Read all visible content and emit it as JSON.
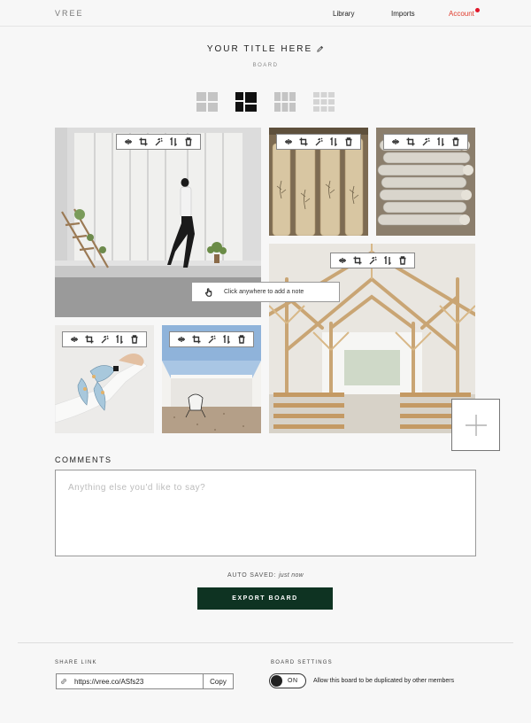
{
  "brand": "VREE",
  "nav": {
    "library": "Library",
    "imports": "Imports",
    "account": "Account",
    "account_notification": true
  },
  "board": {
    "title": "YOUR TITLE HERE",
    "subtitle": "BOARD"
  },
  "layouts": {
    "selected": 1,
    "options": [
      "2x2 grid",
      "mosaic",
      "3x2 grid",
      "3x3 grid"
    ]
  },
  "toolbar_icons": [
    "adjust-icon",
    "crop-icon",
    "magic-wand-icon",
    "flip-icon",
    "trash-icon"
  ],
  "photos": [
    "Person walking in a white gallery with ladder and plants",
    "Rolled paper scrolls with botanical drawings",
    "Stacked rolled fabric swatches",
    "Timber-framed chapel interior with pews",
    "Wrist with patterned silk scarf",
    "Butterfly chair in an open courtyard"
  ],
  "note_prompt": "Click anywhere to add a note",
  "comments": {
    "label": "COMMENTS",
    "placeholder": "Anything else you'd like to say?",
    "value": ""
  },
  "autosave": {
    "label": "AUTO SAVED:",
    "time": "just now"
  },
  "export_label": "EXPORT BOARD",
  "share": {
    "label": "SHARE LINK",
    "url": "https://vree.co/ASfs23",
    "copy_label": "Copy"
  },
  "settings": {
    "label": "BOARD SETTINGS",
    "toggle_state": "ON",
    "toggle_desc": "Allow this board to be duplicated by other members"
  },
  "colors": {
    "accent": "#0e3322",
    "account": "#e03a2b",
    "notification": "#e0172a"
  }
}
